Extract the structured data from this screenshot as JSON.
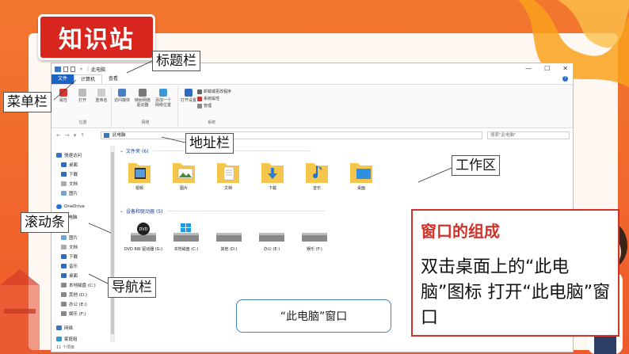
{
  "slide": {
    "title": "知识站",
    "accent_color": "#d8261f",
    "background_color": "#f06a2a"
  },
  "window": {
    "title": "此电脑",
    "menu": {
      "file": "文件",
      "computer": "计算机",
      "view": "查看"
    },
    "controls": [
      "—",
      "☐",
      "✕"
    ],
    "ribbon": {
      "groups": [
        {
          "label": "位置",
          "buttons": [
            "属性",
            "打开",
            "重命名"
          ]
        },
        {
          "label": "网络",
          "buttons": [
            "访问媒体",
            "映射网络驱动器",
            "添加一个网络位置"
          ]
        },
        {
          "label": "系统",
          "buttons": [
            "打开设置"
          ],
          "small": [
            "卸载或更改程序",
            "系统属性",
            "管理"
          ]
        }
      ]
    },
    "address": {
      "path": "此电脑",
      "search_placeholder": "搜索\"此电脑\""
    },
    "nav": {
      "quick_access": "快速访问",
      "items": [
        "桌面",
        "下载",
        "文档",
        "图片",
        "OneDrive",
        "此电脑",
        "图片",
        "文档",
        "下载",
        "音乐",
        "桌面",
        "本地磁盘 (C:)",
        "其他 (D:)",
        "办公 (E:)",
        "娱乐 (F:)",
        "网络",
        "家庭组"
      ]
    },
    "status": "11 个项目",
    "folders_header": "文件夹 (6)",
    "folders": [
      "视频",
      "图片",
      "文档",
      "下载",
      "音乐",
      "桌面"
    ],
    "drives_header": "设备和驱动器 (5)",
    "drives": [
      "DVD RW 驱动器 (G:)",
      "本地磁盘 (C:)",
      "其他 (D:)",
      "办公 (E:)",
      "娱乐 (F:)"
    ]
  },
  "callouts": {
    "titlebar": "标题栏",
    "menubar": "菜单栏",
    "addressbar": "地址栏",
    "workspace": "工作区",
    "scrollbar": "滚动条",
    "navpane": "导航栏",
    "window_caption": "“此电脑”窗口"
  },
  "info": {
    "title": "窗口的组成",
    "body": "双击桌面上的“此电脑”图标 打开“此电脑”窗口"
  }
}
